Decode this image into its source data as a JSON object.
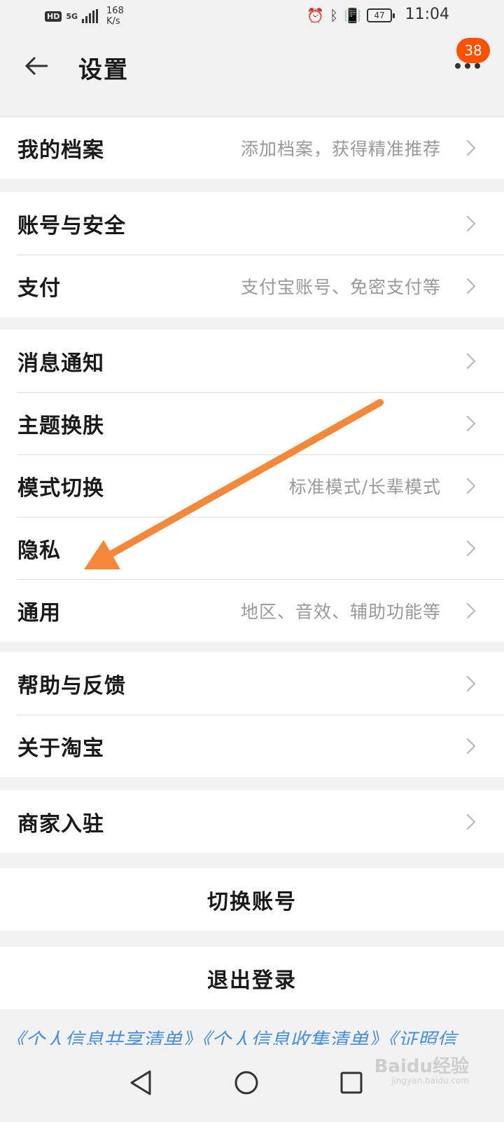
{
  "status_bar": {
    "hd": "HD",
    "network": "5G",
    "speed_value": "168",
    "speed_unit": "K/s",
    "battery": "47",
    "time": "11:04"
  },
  "header": {
    "title": "设置",
    "notification_count": "38"
  },
  "groups": [
    {
      "items": [
        {
          "label": "我的档案",
          "hint": "添加档案，获得精准推荐"
        }
      ]
    },
    {
      "items": [
        {
          "label": "账号与安全",
          "hint": ""
        },
        {
          "label": "支付",
          "hint": "支付宝账号、免密支付等"
        }
      ]
    },
    {
      "items": [
        {
          "label": "消息通知",
          "hint": ""
        },
        {
          "label": "主题换肤",
          "hint": ""
        },
        {
          "label": "模式切换",
          "hint": "标准模式/长辈模式"
        },
        {
          "label": "隐私",
          "hint": ""
        },
        {
          "label": "通用",
          "hint": "地区、音效、辅助功能等"
        }
      ]
    },
    {
      "items": [
        {
          "label": "帮助与反馈",
          "hint": ""
        },
        {
          "label": "关于淘宝",
          "hint": ""
        }
      ]
    },
    {
      "items": [
        {
          "label": "商家入驻",
          "hint": ""
        }
      ]
    }
  ],
  "actions": {
    "switch_account": "切换账号",
    "logout": "退出登录"
  },
  "footer": {
    "links_text": "《个人信息共享清单》《个人信息收集清单》《证照信"
  },
  "watermark": {
    "brand": "Baidu经验",
    "site": "jingyan.baidu.com"
  },
  "colors": {
    "accent": "#ff5000",
    "annotation_arrow": "#f5873a",
    "link": "#4a90d9"
  }
}
